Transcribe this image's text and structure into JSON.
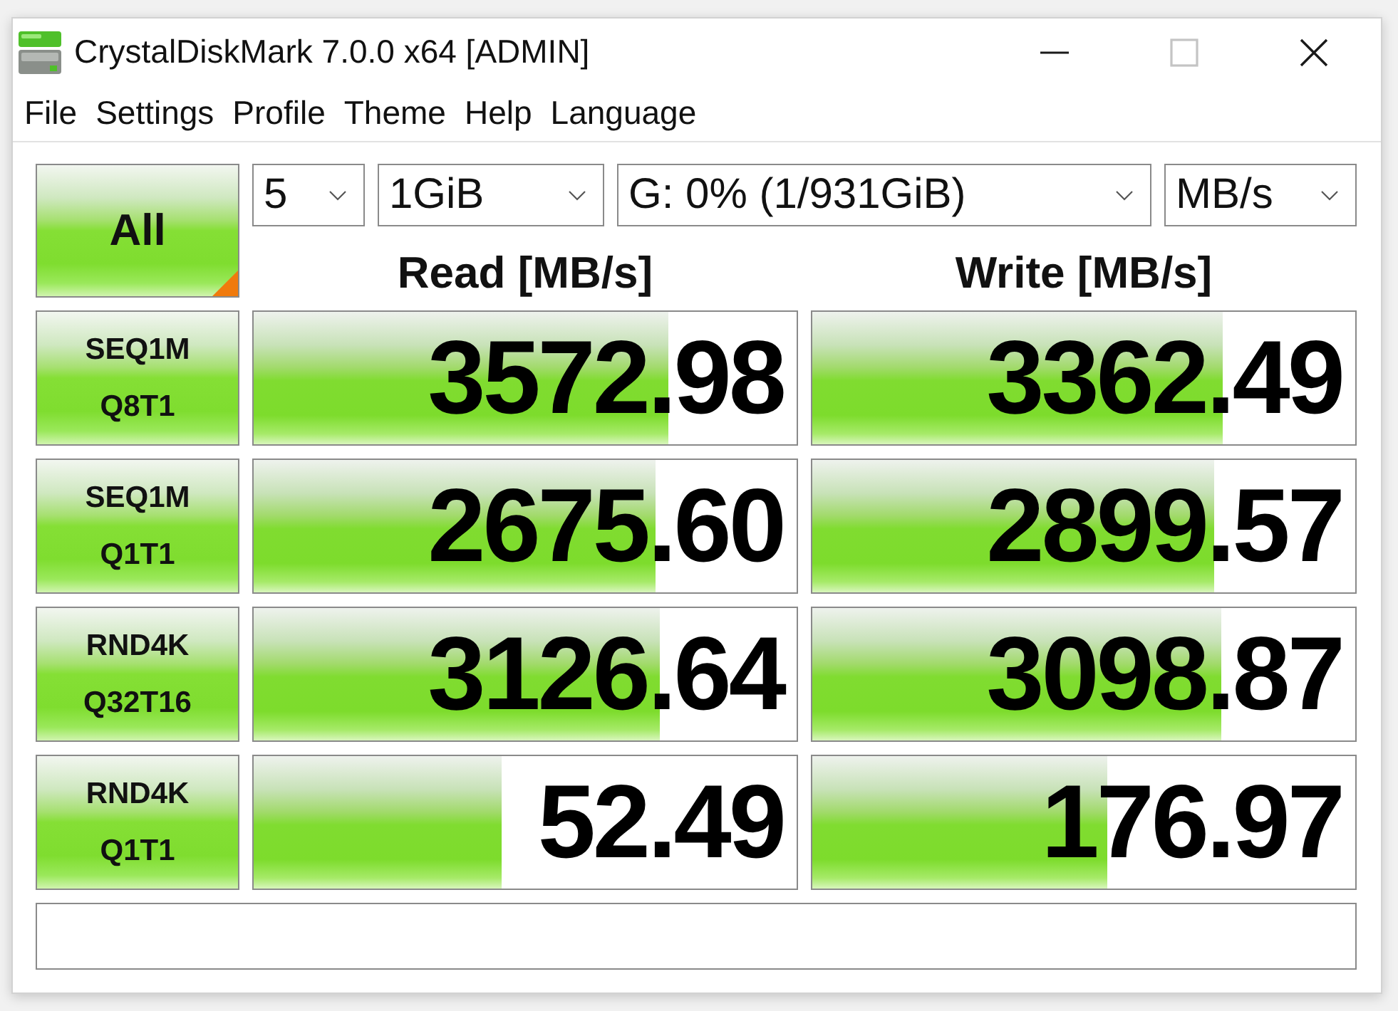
{
  "window": {
    "title": "CrystalDiskMark 7.0.0 x64 [ADMIN]",
    "controls": [
      {
        "kind": "minimize",
        "disabled": false
      },
      {
        "kind": "maximize",
        "disabled": true
      },
      {
        "kind": "close",
        "disabled": false
      }
    ]
  },
  "menu": {
    "items": [
      "File",
      "Settings",
      "Profile",
      "Theme",
      "Help",
      "Language"
    ]
  },
  "toolbar": {
    "all_button": "All",
    "dropdowns": [
      {
        "value": "5"
      },
      {
        "value": "1GiB"
      },
      {
        "value": "G: 0% (1/931GiB)"
      },
      {
        "value": "MB/s"
      }
    ]
  },
  "columns": [
    "Read [MB/s]",
    "Write [MB/s]"
  ],
  "tests": [
    {
      "label": [
        "SEQ1M",
        "Q8T1"
      ],
      "results": [
        {
          "value": "3572.98",
          "level": 0.765
        },
        {
          "value": "3362.49",
          "level": 0.755
        }
      ]
    },
    {
      "label": [
        "SEQ1M",
        "Q1T1"
      ],
      "results": [
        {
          "value": "2675.60",
          "level": 0.739
        },
        {
          "value": "2899.57",
          "level": 0.739
        }
      ]
    },
    {
      "label": [
        "RND4K",
        "Q32T16"
      ],
      "results": [
        {
          "value": "3126.64",
          "level": 0.747
        },
        {
          "value": "3098.87",
          "level": 0.752
        }
      ]
    },
    {
      "label": [
        "RND4K",
        "Q1T1"
      ],
      "results": [
        {
          "value": "52.49",
          "level": 0.457
        },
        {
          "value": "176.97",
          "level": 0.543
        }
      ]
    }
  ]
}
